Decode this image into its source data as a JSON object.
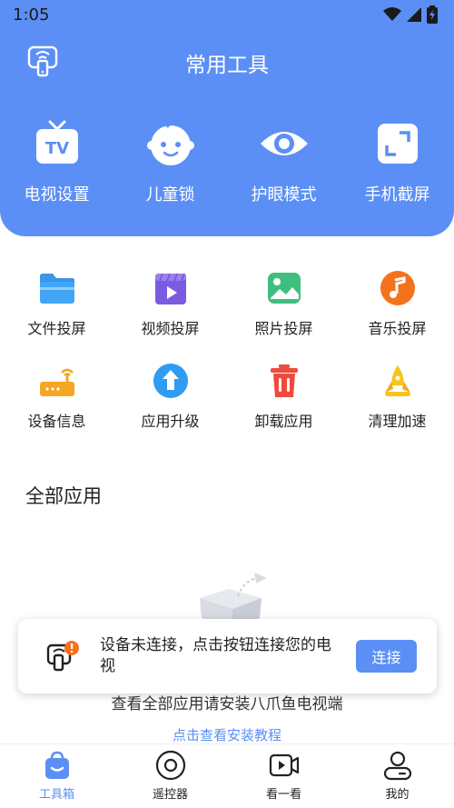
{
  "status_bar": {
    "time": "1:05"
  },
  "header": {
    "title": "常用工具"
  },
  "top_tools": [
    {
      "label": "电视设置",
      "icon": "tv-icon"
    },
    {
      "label": "儿童锁",
      "icon": "child-face-icon"
    },
    {
      "label": "护眼模式",
      "icon": "eye-icon"
    },
    {
      "label": "手机截屏",
      "icon": "screenshot-icon"
    }
  ],
  "grid_tools": [
    {
      "label": "文件投屏",
      "icon": "folder-icon"
    },
    {
      "label": "视频投屏",
      "icon": "video-icon"
    },
    {
      "label": "照片投屏",
      "icon": "photo-icon"
    },
    {
      "label": "音乐投屏",
      "icon": "music-icon"
    },
    {
      "label": "设备信息",
      "icon": "router-icon"
    },
    {
      "label": "应用升级",
      "icon": "upgrade-icon"
    },
    {
      "label": "卸载应用",
      "icon": "trash-icon"
    },
    {
      "label": "清理加速",
      "icon": "rocket-icon"
    }
  ],
  "all_apps": {
    "title": "全部应用",
    "empty_text": "查看全部应用请安装八爪鱼电视端",
    "tutorial_link": "点击查看安装教程"
  },
  "toast": {
    "message": "设备未连接，点击按钮连接您的电视",
    "button": "连接"
  },
  "tabs": [
    {
      "label": "工具箱",
      "active": true,
      "icon": "toolbox-icon"
    },
    {
      "label": "遥控器",
      "active": false,
      "icon": "remote-icon"
    },
    {
      "label": "看一看",
      "active": false,
      "icon": "video-camera-icon"
    },
    {
      "label": "我的",
      "active": false,
      "icon": "user-icon"
    }
  ],
  "colors": {
    "accent": "#5b8ff5",
    "background": "#ffffff"
  }
}
